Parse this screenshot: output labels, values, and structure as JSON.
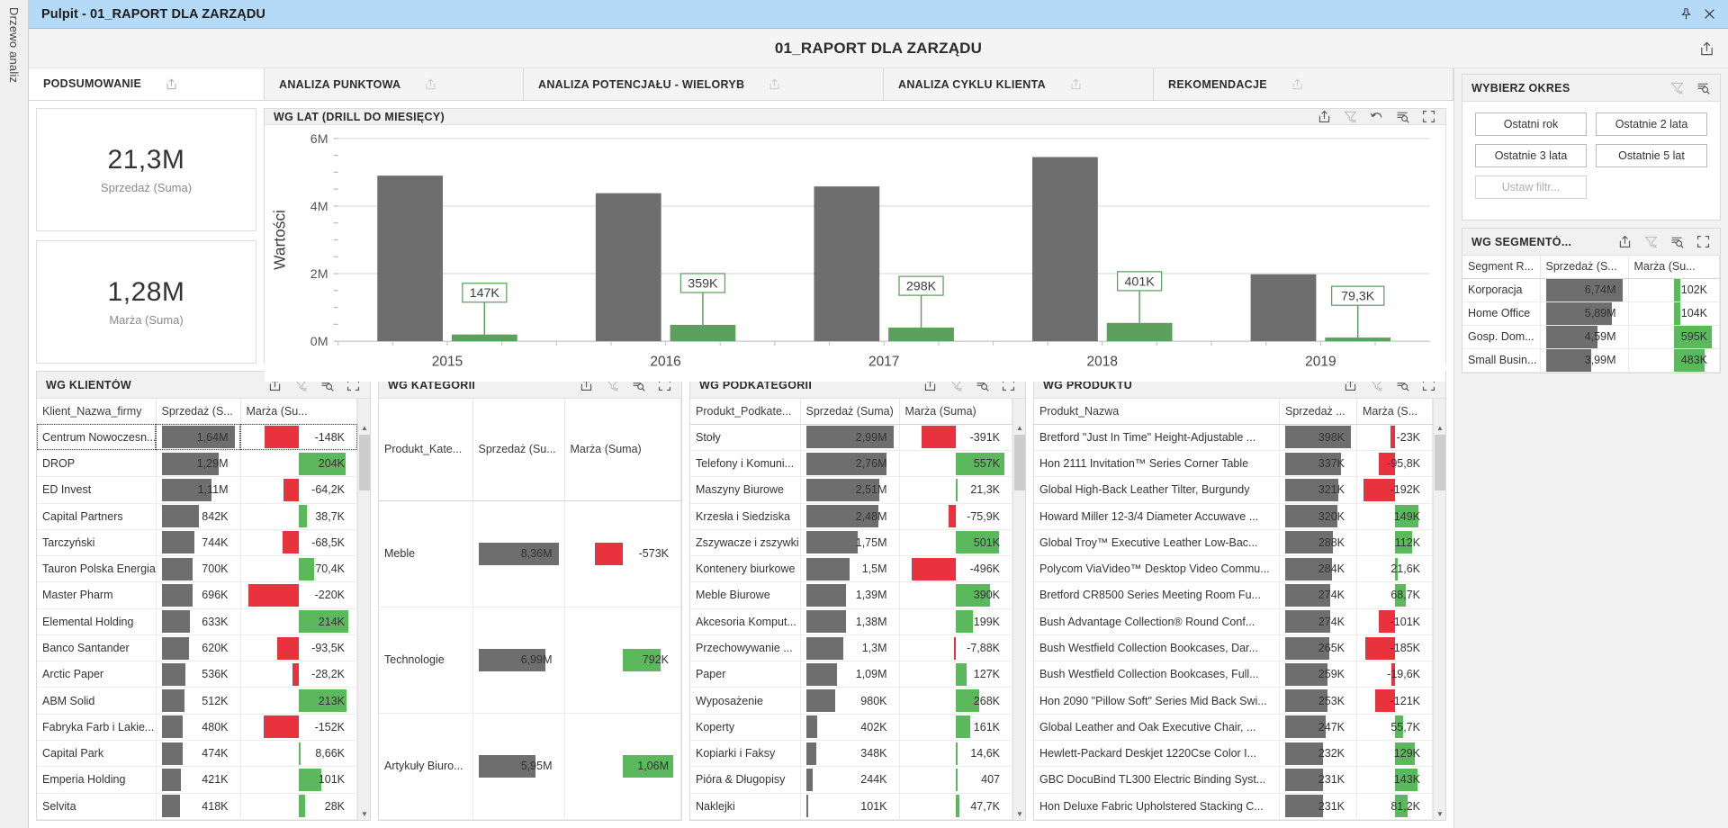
{
  "window": {
    "title": "Pulpit - 01_RAPORT DLA ZARZĄDU",
    "pin_icon": "pin-icon",
    "close_icon": "close-icon"
  },
  "report": {
    "title": "01_RAPORT DLA ZARZĄDU",
    "export_icon": "export-icon"
  },
  "tabs": [
    {
      "label": "PODSUMOWANIE",
      "active": true
    },
    {
      "label": "ANALIZA PUNKTOWA",
      "active": false
    },
    {
      "label": "ANALIZA POTENCJAŁU - WIELORYB",
      "active": false
    },
    {
      "label": "ANALIZA CYKLU KLIENTA",
      "active": false
    },
    {
      "label": "REKOMENDACJE",
      "active": false
    }
  ],
  "kpis": [
    {
      "value": "21,3M",
      "label": "Sprzedaż (Suma)"
    },
    {
      "value": "1,28M",
      "label": "Marża (Suma)"
    }
  ],
  "chart_panel": {
    "title": "WG LAT (DRILL DO MIESIĘCY)",
    "tools": [
      "export-icon",
      "clear-filter-icon",
      "undo-icon",
      "sort-search-icon",
      "fullscreen-icon"
    ]
  },
  "chart_data": {
    "type": "bar",
    "title": "WG LAT (DRILL DO MIESIĘCY)",
    "xlabel": "",
    "ylabel": "Wartości",
    "categories": [
      "2015",
      "2016",
      "2017",
      "2018",
      "2019"
    ],
    "ylim": [
      0,
      6000000
    ],
    "ytick_labels": [
      "0M",
      "2M",
      "4M",
      "6M"
    ],
    "ytick_values": [
      0,
      2000000,
      4000000,
      6000000
    ],
    "grid": true,
    "legend": "none",
    "series": [
      {
        "name": "Sprzedaż (Suma)",
        "color": "#6e6e6e",
        "values": [
          4900000,
          4380000,
          4580000,
          5450000,
          1980000
        ],
        "labels": [
          "",
          "",
          "",
          "",
          ""
        ]
      },
      {
        "name": "Marża (Suma)",
        "color": "#5aa койn",
        "values": [
          147000,
          359000,
          298000,
          401000,
          79300
        ],
        "labels": [
          "147K",
          "359K",
          "298K",
          "401K",
          "79,3K"
        ]
      }
    ]
  },
  "tables": [
    {
      "id": "klienci",
      "title": "WG KLIENTÓW",
      "tools": [
        "export-icon",
        "clear-filter-icon",
        "sort-search-icon",
        "fullscreen-icon"
      ],
      "columns": [
        "Klient_Nazwa_firmy",
        "Sprzedaż (S...",
        "Marża (Su..."
      ],
      "sales_max": 1640000,
      "marg_max": 220000,
      "rows": [
        {
          "name": "Centrum Nowoczesn...",
          "sales": "1,64M",
          "sales_v": 1640000,
          "marg": "-148K",
          "marg_v": -148000,
          "selected": true
        },
        {
          "name": "DROP",
          "sales": "1,29M",
          "sales_v": 1290000,
          "marg": "204K",
          "marg_v": 204000
        },
        {
          "name": "ED Invest",
          "sales": "1,11M",
          "sales_v": 1110000,
          "marg": "-64,2K",
          "marg_v": -64200
        },
        {
          "name": "Capital Partners",
          "sales": "842K",
          "sales_v": 842000,
          "marg": "38,7K",
          "marg_v": 38700
        },
        {
          "name": "Tarczyński",
          "sales": "744K",
          "sales_v": 744000,
          "marg": "-68,5K",
          "marg_v": -68500
        },
        {
          "name": "Tauron Polska Energia",
          "sales": "700K",
          "sales_v": 700000,
          "marg": "70,4K",
          "marg_v": 70400
        },
        {
          "name": "Master Pharm",
          "sales": "696K",
          "sales_v": 696000,
          "marg": "-220K",
          "marg_v": -220000
        },
        {
          "name": "Elemental Holding",
          "sales": "633K",
          "sales_v": 633000,
          "marg": "214K",
          "marg_v": 214000
        },
        {
          "name": "Banco Santander",
          "sales": "620K",
          "sales_v": 620000,
          "marg": "-93,5K",
          "marg_v": -93500
        },
        {
          "name": "Arctic Paper",
          "sales": "536K",
          "sales_v": 536000,
          "marg": "-28,2K",
          "marg_v": -28200
        },
        {
          "name": "ABM Solid",
          "sales": "512K",
          "sales_v": 512000,
          "marg": "213K",
          "marg_v": 213000
        },
        {
          "name": "Fabryka Farb i Lakie...",
          "sales": "480K",
          "sales_v": 480000,
          "marg": "-152K",
          "marg_v": -152000
        },
        {
          "name": "Capital Park",
          "sales": "474K",
          "sales_v": 474000,
          "marg": "8,66K",
          "marg_v": 8660
        },
        {
          "name": "Emperia Holding",
          "sales": "421K",
          "sales_v": 421000,
          "marg": "101K",
          "marg_v": 101000
        },
        {
          "name": "Selvita",
          "sales": "418K",
          "sales_v": 418000,
          "marg": "28K",
          "marg_v": 28000
        }
      ]
    },
    {
      "id": "kategorie",
      "title": "WG KATEGORII",
      "tools": [
        "export-icon",
        "clear-filter-icon",
        "sort-search-icon",
        "fullscreen-icon"
      ],
      "columns": [
        "Produkt_Kate...",
        "Sprzedaż (Su...",
        "Marża (Suma)"
      ],
      "sales_max": 8360000,
      "marg_max": 1060000,
      "rows": [
        {
          "name": "Meble",
          "sales": "8,36M",
          "sales_v": 8360000,
          "marg": "-573K",
          "marg_v": -573000
        },
        {
          "name": "Technologie",
          "sales": "6,99M",
          "sales_v": 6990000,
          "marg": "792K",
          "marg_v": 792000
        },
        {
          "name": "Artykuły Biuro...",
          "sales": "5,95M",
          "sales_v": 5950000,
          "marg": "1,06M",
          "marg_v": 1060000
        }
      ]
    },
    {
      "id": "podkategorie",
      "title": "WG PODKATEGORII",
      "tools": [
        "export-icon",
        "clear-filter-icon",
        "sort-search-icon",
        "fullscreen-icon"
      ],
      "columns": [
        "Produkt_Podkate...",
        "Sprzedaż (Suma)",
        "Marża (Suma)"
      ],
      "sales_max": 2990000,
      "marg_max": 557000,
      "rows": [
        {
          "name": "Stoły",
          "sales": "2,99M",
          "sales_v": 2990000,
          "marg": "-391K",
          "marg_v": -391000
        },
        {
          "name": "Telefony i Komuni...",
          "sales": "2,76M",
          "sales_v": 2760000,
          "marg": "557K",
          "marg_v": 557000
        },
        {
          "name": "Maszyny Biurowe",
          "sales": "2,51M",
          "sales_v": 2510000,
          "marg": "21,3K",
          "marg_v": 21300
        },
        {
          "name": "Krzesła i Siedziska",
          "sales": "2,48M",
          "sales_v": 2480000,
          "marg": "-75,9K",
          "marg_v": -75900
        },
        {
          "name": "Zszywacze i zszywki",
          "sales": "1,75M",
          "sales_v": 1750000,
          "marg": "501K",
          "marg_v": 501000
        },
        {
          "name": "Kontenery biurkowe",
          "sales": "1,5M",
          "sales_v": 1500000,
          "marg": "-496K",
          "marg_v": -496000
        },
        {
          "name": "Meble Biurowe",
          "sales": "1,39M",
          "sales_v": 1390000,
          "marg": "390K",
          "marg_v": 390000
        },
        {
          "name": "Akcesoria Komput...",
          "sales": "1,38M",
          "sales_v": 1380000,
          "marg": "199K",
          "marg_v": 199000
        },
        {
          "name": "Przechowywanie ...",
          "sales": "1,3M",
          "sales_v": 1300000,
          "marg": "-7,88K",
          "marg_v": -7880
        },
        {
          "name": "Paper",
          "sales": "1,09M",
          "sales_v": 1090000,
          "marg": "127K",
          "marg_v": 127000
        },
        {
          "name": "Wyposażenie",
          "sales": "980K",
          "sales_v": 980000,
          "marg": "268K",
          "marg_v": 268000
        },
        {
          "name": "Koperty",
          "sales": "402K",
          "sales_v": 402000,
          "marg": "161K",
          "marg_v": 161000
        },
        {
          "name": "Kopiarki i Faksy",
          "sales": "348K",
          "sales_v": 348000,
          "marg": "14,6K",
          "marg_v": 14600
        },
        {
          "name": "Pióra & Długopisy",
          "sales": "244K",
          "sales_v": 244000,
          "marg": "407",
          "marg_v": 407
        },
        {
          "name": "Naklejki",
          "sales": "101K",
          "sales_v": 101000,
          "marg": "47,7K",
          "marg_v": 47700
        }
      ]
    },
    {
      "id": "produkty",
      "title": "WG PRODUKTU",
      "tools": [
        "export-icon",
        "clear-filter-icon",
        "sort-search-icon",
        "fullscreen-icon"
      ],
      "columns": [
        "Produkt_Nazwa",
        "Sprzedaż ...",
        "Marża (S..."
      ],
      "sales_max": 398000,
      "marg_max": 192000,
      "rows": [
        {
          "name": "Bretford \"Just In Time\" Height-Adjustable ...",
          "sales": "398K",
          "sales_v": 398000,
          "marg": "-23K",
          "marg_v": -23000
        },
        {
          "name": "Hon 2111 Invitation™ Series Corner Table",
          "sales": "337K",
          "sales_v": 337000,
          "marg": "-95,8K",
          "marg_v": -95800
        },
        {
          "name": "Global High-Back Leather Tilter, Burgundy",
          "sales": "321K",
          "sales_v": 321000,
          "marg": "-192K",
          "marg_v": -192000
        },
        {
          "name": "Howard Miller 12-3/4 Diameter Accuwave ...",
          "sales": "320K",
          "sales_v": 320000,
          "marg": "149K",
          "marg_v": 149000
        },
        {
          "name": "Global Troy™ Executive Leather Low-Bac...",
          "sales": "288K",
          "sales_v": 288000,
          "marg": "112K",
          "marg_v": 112000
        },
        {
          "name": "Polycom ViaVideo™ Desktop Video Commu...",
          "sales": "284K",
          "sales_v": 284000,
          "marg": "21,6K",
          "marg_v": 21600
        },
        {
          "name": "Bretford CR8500 Series Meeting Room Fu...",
          "sales": "274K",
          "sales_v": 274000,
          "marg": "68,7K",
          "marg_v": 68700
        },
        {
          "name": "Bush Advantage Collection® Round Conf...",
          "sales": "274K",
          "sales_v": 274000,
          "marg": "-101K",
          "marg_v": -101000
        },
        {
          "name": "Bush Westfield Collection Bookcases, Dar...",
          "sales": "265K",
          "sales_v": 265000,
          "marg": "-185K",
          "marg_v": -185000
        },
        {
          "name": "Bush Westfield Collection Bookcases, Full...",
          "sales": "259K",
          "sales_v": 259000,
          "marg": "-19,6K",
          "marg_v": -19600
        },
        {
          "name": "Hon 2090 \"Pillow Soft\" Series Mid Back Swi...",
          "sales": "253K",
          "sales_v": 253000,
          "marg": "-121K",
          "marg_v": -121000
        },
        {
          "name": "Global Leather and Oak Executive Chair, ...",
          "sales": "247K",
          "sales_v": 247000,
          "marg": "55,7K",
          "marg_v": 55700
        },
        {
          "name": "Hewlett-Packard Deskjet 1220Cse Color I...",
          "sales": "232K",
          "sales_v": 232000,
          "marg": "129K",
          "marg_v": 129000
        },
        {
          "name": "GBC DocuBind TL300 Electric Binding Syst...",
          "sales": "231K",
          "sales_v": 231000,
          "marg": "143K",
          "marg_v": 143000
        },
        {
          "name": "Hon Deluxe Fabric Upholstered Stacking C...",
          "sales": "231K",
          "sales_v": 231000,
          "marg": "81,2K",
          "marg_v": 81200
        }
      ]
    }
  ],
  "period_panel": {
    "title": "WYBIERZ OKRES",
    "tools": [
      "clear-filter-icon",
      "sort-search-icon"
    ],
    "buttons": [
      {
        "label": "Ostatni rok",
        "dim": false
      },
      {
        "label": "Ostatnie 2 lata",
        "dim": false
      },
      {
        "label": "Ostatnie 3 lata",
        "dim": false
      },
      {
        "label": "Ostatnie 5 lat",
        "dim": false
      },
      {
        "label": "Ustaw filtr...",
        "dim": true
      }
    ]
  },
  "segment_panel": {
    "title": "WG SEGMENTÓ...",
    "tools": [
      "export-icon",
      "clear-filter-icon",
      "sort-search-icon",
      "fullscreen-icon"
    ],
    "columns": [
      "Segment R...",
      "Sprzedaż (S...",
      "Marża (Su..."
    ],
    "sales_max": 6740000,
    "marg_max": 595000,
    "rows": [
      {
        "name": "Korporacja",
        "sales": "6,74M",
        "sales_v": 6740000,
        "marg": "102K",
        "marg_v": 102000
      },
      {
        "name": "Home Office",
        "sales": "5,89M",
        "sales_v": 5890000,
        "marg": "104K",
        "marg_v": 104000
      },
      {
        "name": "Gosp. Dom...",
        "sales": "4,59M",
        "sales_v": 4590000,
        "marg": "595K",
        "marg_v": 595000
      },
      {
        "name": "Small Busin...",
        "sales": "3,99M",
        "sales_v": 3990000,
        "marg": "483K",
        "marg_v": 483000
      }
    ]
  },
  "sidebar": {
    "label": "Drzewo analiz"
  },
  "colors": {
    "bar_gray": "#6e6e6e",
    "green": "#5cb85c",
    "green_dark": "#4e9e4e",
    "red": "#e8333f",
    "title_bar": "#b5daf7"
  }
}
